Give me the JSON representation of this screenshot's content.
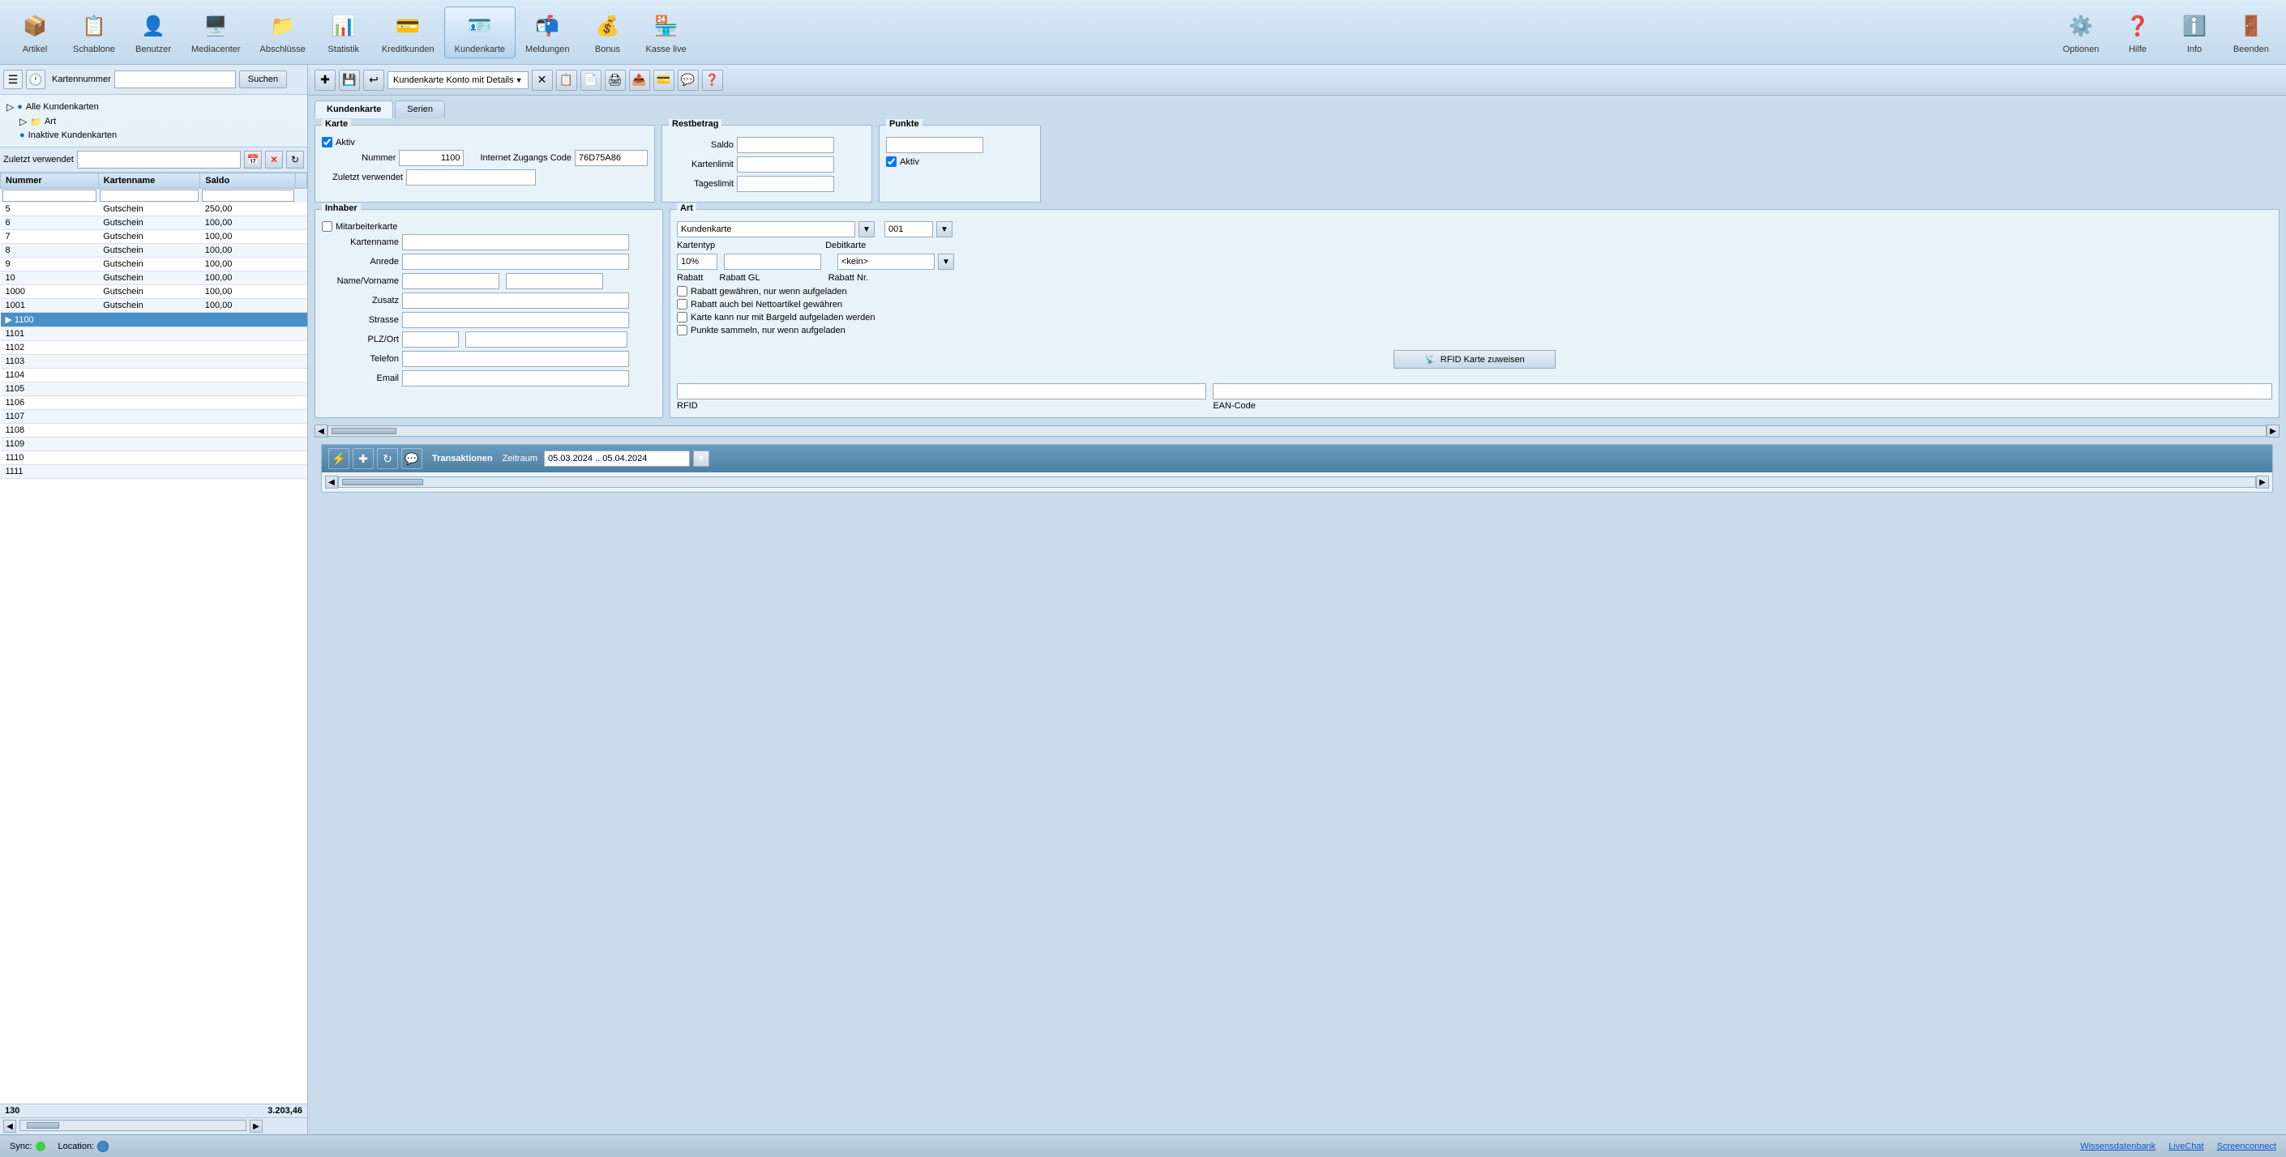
{
  "toolbar": {
    "items": [
      {
        "label": "Artikel",
        "icon": "📦",
        "active": false
      },
      {
        "label": "Schablone",
        "icon": "📋",
        "active": false
      },
      {
        "label": "Benutzer",
        "icon": "👤",
        "active": false
      },
      {
        "label": "Mediacenter",
        "icon": "🖥️",
        "active": false
      },
      {
        "label": "Abschlüsse",
        "icon": "📁",
        "active": false
      },
      {
        "label": "Statistik",
        "icon": "📊",
        "active": false
      },
      {
        "label": "Kreditkunden",
        "icon": "💳",
        "active": false
      },
      {
        "label": "Kundenkarte",
        "icon": "💳",
        "active": true
      },
      {
        "label": "Meldungen",
        "icon": "📬",
        "active": false
      },
      {
        "label": "Bonus",
        "icon": "💰",
        "active": false
      },
      {
        "label": "Kasse live",
        "icon": "🏪",
        "active": false
      },
      {
        "label": "Optionen",
        "icon": "⚙️",
        "active": false
      },
      {
        "label": "Hilfe",
        "icon": "❓",
        "active": false
      },
      {
        "label": "Info",
        "icon": "ℹ️",
        "active": false
      },
      {
        "label": "Beenden",
        "icon": "🚪",
        "active": false
      }
    ]
  },
  "left_panel": {
    "search_label": "Kartennummer",
    "search_placeholder": "",
    "search_button": "Suchen",
    "tree": [
      {
        "label": "Alle Kundenkarten",
        "indent": 0,
        "icon": "🔵"
      },
      {
        "label": "Art",
        "indent": 1,
        "icon": "📁"
      },
      {
        "label": "Inaktive Kundenkarten",
        "indent": 1,
        "icon": "🔵"
      }
    ],
    "filter_placeholder": "Zuletzt verwendet",
    "table": {
      "columns": [
        "Nummer",
        "Kartenname",
        "Saldo"
      ],
      "rows": [
        {
          "nummer": "5",
          "kartenname": "Gutschein",
          "saldo": "250,00",
          "selected": false
        },
        {
          "nummer": "6",
          "kartenname": "Gutschein",
          "saldo": "100,00",
          "selected": false
        },
        {
          "nummer": "7",
          "kartenname": "Gutschein",
          "saldo": "100,00",
          "selected": false
        },
        {
          "nummer": "8",
          "kartenname": "Gutschein",
          "saldo": "100,00",
          "selected": false
        },
        {
          "nummer": "9",
          "kartenname": "Gutschein",
          "saldo": "100,00",
          "selected": false
        },
        {
          "nummer": "10",
          "kartenname": "Gutschein",
          "saldo": "100,00",
          "selected": false
        },
        {
          "nummer": "1000",
          "kartenname": "Gutschein",
          "saldo": "100,00",
          "selected": false
        },
        {
          "nummer": "1001",
          "kartenname": "Gutschein",
          "saldo": "100,00",
          "selected": false
        },
        {
          "nummer": "1100",
          "kartenname": "",
          "saldo": "",
          "selected": true
        },
        {
          "nummer": "1101",
          "kartenname": "",
          "saldo": "",
          "selected": false
        },
        {
          "nummer": "1102",
          "kartenname": "",
          "saldo": "",
          "selected": false
        },
        {
          "nummer": "1103",
          "kartenname": "",
          "saldo": "",
          "selected": false
        },
        {
          "nummer": "1104",
          "kartenname": "",
          "saldo": "",
          "selected": false
        },
        {
          "nummer": "1105",
          "kartenname": "",
          "saldo": "",
          "selected": false
        },
        {
          "nummer": "1106",
          "kartenname": "",
          "saldo": "",
          "selected": false
        },
        {
          "nummer": "1107",
          "kartenname": "",
          "saldo": "",
          "selected": false
        },
        {
          "nummer": "1108",
          "kartenname": "",
          "saldo": "",
          "selected": false
        },
        {
          "nummer": "1109",
          "kartenname": "",
          "saldo": "",
          "selected": false
        },
        {
          "nummer": "1110",
          "kartenname": "",
          "saldo": "",
          "selected": false
        },
        {
          "nummer": "1111",
          "kartenname": "",
          "saldo": "",
          "selected": false
        }
      ],
      "footer_number": "130",
      "footer_saldo": "3.203,46"
    }
  },
  "second_toolbar": {
    "dropdown_label": "Kundenkarte Konto mit Details"
  },
  "tabs": [
    {
      "label": "Kundenkarte",
      "active": true
    },
    {
      "label": "Serien",
      "active": false
    }
  ],
  "form": {
    "karte": {
      "title": "Karte",
      "aktiv_checked": true,
      "aktiv_label": "Aktiv",
      "nummer_label": "Nummer",
      "nummer_value": "1100",
      "internet_code_label": "Internet Zugangs Code",
      "internet_code_value": "76D75A86",
      "zuletzt_label": "Zuletzt verwendet",
      "zuletzt_value": ""
    },
    "restbetrag": {
      "title": "Restbetrag",
      "saldo_label": "Saldo",
      "saldo_value": "",
      "kartenlimit_label": "Kartenlimit",
      "kartenlimit_value": "",
      "tageslimit_label": "Tageslimit",
      "tageslimit_value": ""
    },
    "punkte": {
      "title": "Punkte",
      "punkte_value": "",
      "aktiv_checked": true,
      "aktiv_label": "Aktiv"
    },
    "inhaber": {
      "title": "Inhaber",
      "mitarbeiterkarte_checked": false,
      "mitarbeiterkarte_label": "Mitarbeiterkarte",
      "kartenname_label": "Kartenname",
      "kartenname_value": "",
      "anrede_label": "Anrede",
      "anrede_value": "",
      "name_label": "Name/Vorname",
      "name_value": "",
      "vorname_value": "",
      "zusatz_label": "Zusatz",
      "zusatz_value": "",
      "strasse_label": "Strasse",
      "strasse_value": "",
      "plz_label": "PLZ/Ort",
      "plz_value": "",
      "ort_value": "",
      "telefon_label": "Telefon",
      "telefon_value": "",
      "email_label": "Email",
      "email_value": ""
    },
    "art": {
      "title": "Art",
      "kundenkarte_label": "Kundenkarte",
      "kundenkarte_value": "001",
      "kartentyp_label": "Kartentyp",
      "kartentyp_percent": "10%",
      "kartentyp_value": "",
      "debitkarte_label": "Debitkarte",
      "debitkarte_value": "<kein>",
      "rabatt_label": "Rabatt",
      "rabatt_gl_label": "Rabatt GL",
      "rabatt_nr_label": "Rabatt Nr.",
      "cb1_label": "Rabatt gewähren, nur wenn aufgeladen",
      "cb1_checked": false,
      "cb2_label": "Rabatt auch bei Nettoartikel gewähren",
      "cb2_checked": false,
      "cb3_label": "Karte kann nur mit Bargeld aufgeladen werden",
      "cb3_checked": false,
      "cb4_label": "Punkte sammeln, nur wenn aufgeladen",
      "cb4_checked": false,
      "rfid_btn_label": "RFID Karte zuweisen",
      "rfid_label": "RFID",
      "rfid_value": "",
      "ean_label": "EAN-Code",
      "ean_value": ""
    }
  },
  "transaktionen": {
    "title": "Transaktionen",
    "zeitraum_label": "Zeitraum",
    "zeitraum_value": "05.03.2024 .. 05.04.2024"
  },
  "status_bar": {
    "sync_label": "Sync:",
    "location_label": "Location:",
    "links": [
      "Wissensdatenbank",
      "LiveChat",
      "Screenconnect"
    ]
  }
}
